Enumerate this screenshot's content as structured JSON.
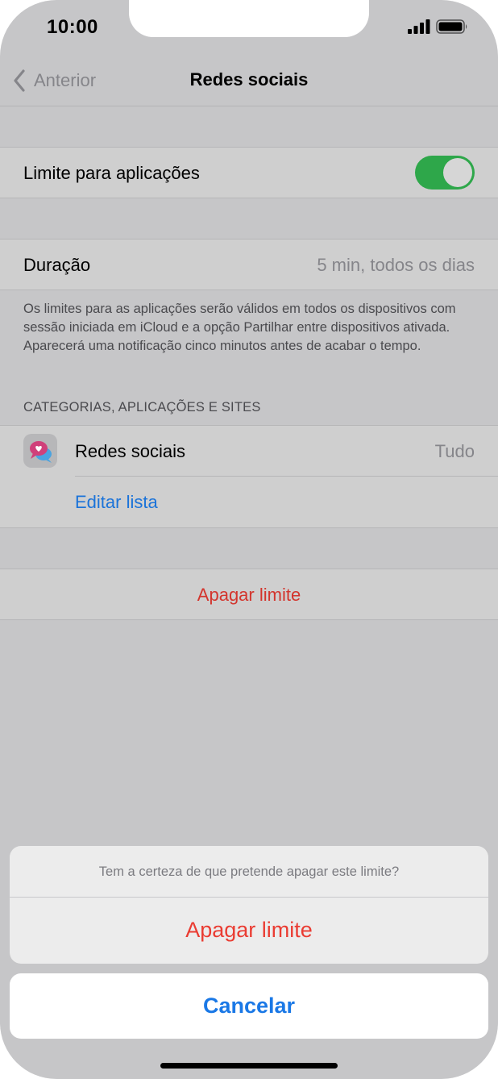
{
  "status_bar": {
    "time": "10:00",
    "signal_icon": "cellular-signal-icon",
    "battery_icon": "battery-icon"
  },
  "nav": {
    "back_label": "Anterior",
    "back_icon": "chevron-left-icon",
    "title": "Redes sociais"
  },
  "limit_toggle": {
    "label": "Limite para aplicações",
    "on": true,
    "color": "#34c759"
  },
  "duration": {
    "label": "Duração",
    "value": "5 min, todos os dias"
  },
  "footnote": "Os limites para as aplicações serão válidos em todos os dispositivos com sessão iniciada em iCloud e a opção Partilhar entre dispositivos ativada. Aparecerá uma notificação cinco minutos antes de acabar o tempo.",
  "categories": {
    "header": "CATEGORIAS, APLICAÇÕES E SITES",
    "items": [
      {
        "icon": "social-chat-bubbles-icon",
        "label": "Redes sociais",
        "value": "Tudo"
      }
    ],
    "edit_label": "Editar lista"
  },
  "delete_row": {
    "label": "Apagar limite"
  },
  "action_sheet": {
    "message": "Tem a certeza de que pretende apagar este limite?",
    "destructive_label": "Apagar limite",
    "cancel_label": "Cancelar"
  },
  "colors": {
    "accent": "#007aff",
    "destructive": "#ff3b30",
    "toggle_on": "#34c759"
  }
}
